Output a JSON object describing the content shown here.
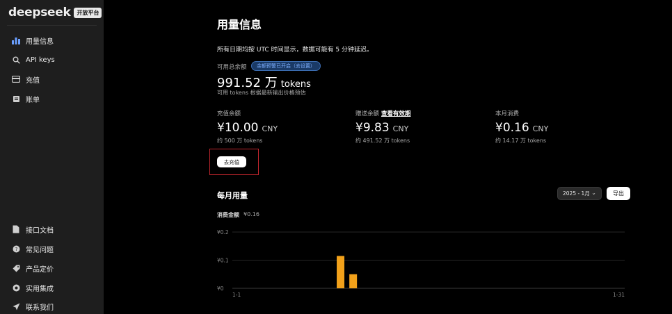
{
  "brand": {
    "name": "deepseek",
    "badge": "开放平台"
  },
  "sidebar": {
    "items": [
      {
        "label": "用量信息",
        "icon": "bar-chart-icon"
      },
      {
        "label": "API keys",
        "icon": "search-icon"
      },
      {
        "label": "充值",
        "icon": "wallet-icon"
      },
      {
        "label": "账单",
        "icon": "bill-icon"
      }
    ],
    "bottom": [
      {
        "label": "接口文档",
        "icon": "document-icon"
      },
      {
        "label": "常见问题",
        "icon": "help-icon"
      },
      {
        "label": "产品定价",
        "icon": "tag-icon"
      },
      {
        "label": "实用集成",
        "icon": "integration-icon"
      },
      {
        "label": "联系我们",
        "icon": "send-icon"
      }
    ]
  },
  "main": {
    "title": "用量信息",
    "notice": "所有日期均按 UTC 时间显示，数据可能有 5 分钟延迟。",
    "available": {
      "label": "可用总余额",
      "pill": "余额预警已开启（去设置）",
      "value": "991.52 万",
      "unit": "tokens",
      "sub": "可用 tokens 根据最新输出价格预估"
    },
    "cards": [
      {
        "label": "充值余额",
        "link": "",
        "amount": "¥10.00",
        "currency": "CNY",
        "sub": "约 500 万 tokens"
      },
      {
        "label": "赠送余额",
        "link": "查看有效期",
        "amount": "¥9.83",
        "currency": "CNY",
        "sub": "约 491.52 万 tokens"
      },
      {
        "label": "本月消费",
        "link": "",
        "amount": "¥0.16",
        "currency": "CNY",
        "sub": "约 14.17 万 tokens"
      }
    ],
    "recharge_button": "去充值",
    "monthly": {
      "title": "每月用量",
      "month": "2025 - 1月",
      "export": "导出",
      "consume_label": "消费金额",
      "consume_value": "¥0.16"
    }
  },
  "chart_data": {
    "type": "bar",
    "x_start_label": "1-1",
    "x_end_label": "1-31",
    "days": 31,
    "ylim": [
      0,
      0.2
    ],
    "yticks": [
      "¥0",
      "¥0.1",
      "¥0.2"
    ],
    "bar_color": "#f2a11a",
    "bars": [
      {
        "day": 9,
        "value": 0.115
      },
      {
        "day": 10,
        "value": 0.05
      }
    ]
  }
}
